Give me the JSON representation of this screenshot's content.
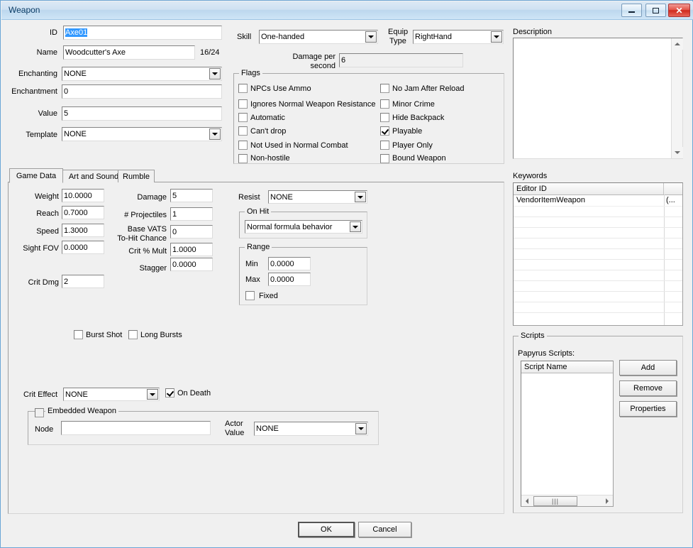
{
  "window": {
    "title": "Weapon",
    "controls": {
      "minimize": "minimize-button",
      "maximize": "maximize-button",
      "close": "close-button"
    }
  },
  "identity": {
    "id_label": "ID",
    "id_value": "Axe01",
    "name_label": "Name",
    "name_value": "Woodcutter's Axe",
    "name_counter": "16/24",
    "enchanting_label": "Enchanting",
    "enchanting_value": "NONE",
    "enchantment_label": "Enchantment",
    "enchantment_value": "0",
    "value_label": "Value",
    "value_value": "5",
    "template_label": "Template",
    "template_value": "NONE"
  },
  "combat": {
    "skill_label": "Skill",
    "skill_value": "One-handed",
    "equip_type_label_line1": "Equip",
    "equip_type_label_line2": "Type",
    "equip_type_value": "RightHand",
    "dps_label_line1": "Damage per",
    "dps_label_line2": "second",
    "dps_value": "6"
  },
  "flags": {
    "title": "Flags",
    "left": [
      {
        "label": "NPCs Use Ammo",
        "checked": false
      },
      {
        "label": "Ignores Normal Weapon Resistance",
        "checked": false
      },
      {
        "label": "Automatic",
        "checked": false
      },
      {
        "label": "Can't drop",
        "checked": false
      },
      {
        "label": "Not Used in Normal Combat",
        "checked": false
      },
      {
        "label": "Non-hostile",
        "checked": false
      }
    ],
    "right": [
      {
        "label": "No Jam After Reload",
        "checked": false
      },
      {
        "label": "Minor Crime",
        "checked": false
      },
      {
        "label": "Hide Backpack",
        "checked": false
      },
      {
        "label": "Playable",
        "checked": true
      },
      {
        "label": "Player Only",
        "checked": false
      },
      {
        "label": "Bound Weapon",
        "checked": false
      }
    ]
  },
  "tabs": [
    {
      "label": "Game Data",
      "active": true
    },
    {
      "label": "Art and Sound",
      "active": false
    },
    {
      "label": "Rumble",
      "active": false
    }
  ],
  "game_data": {
    "weight_label": "Weight",
    "weight_value": "10.0000",
    "reach_label": "Reach",
    "reach_value": "0.7000",
    "speed_label": "Speed",
    "speed_value": "1.3000",
    "sight_fov_label": "Sight FOV",
    "sight_fov_value": "0.0000",
    "crit_dmg_label": "Crit Dmg",
    "crit_dmg_value": "2",
    "damage_label": "Damage",
    "damage_value": "5",
    "projectiles_label": "# Projectiles",
    "projectiles_value": "1",
    "vats_label_line1": "Base VATS",
    "vats_label_line2": "To-Hit Chance",
    "vats_value": "0",
    "crit_mult_label": "Crit % Mult",
    "crit_mult_value": "1.0000",
    "stagger_label": "Stagger",
    "stagger_value": "0.0000"
  },
  "resist": {
    "label": "Resist",
    "value": "NONE"
  },
  "on_hit": {
    "title": "On Hit",
    "value": "Normal formula behavior"
  },
  "range": {
    "title": "Range",
    "min_label": "Min",
    "min_value": "0.0000",
    "max_label": "Max",
    "max_value": "0.0000",
    "fixed_label": "Fixed",
    "fixed_checked": false
  },
  "burst": {
    "burst_shot_label": "Burst Shot",
    "burst_shot_checked": false,
    "long_bursts_label": "Long Bursts",
    "long_bursts_checked": false
  },
  "crit_effect": {
    "label": "Crit Effect",
    "value": "NONE",
    "on_death_label": "On Death",
    "on_death_checked": true
  },
  "embedded_weapon": {
    "title": "Embedded Weapon",
    "enabled": false,
    "node_label": "Node",
    "node_value": "",
    "actor_value_label_line1": "Actor",
    "actor_value_label_line2": "Value",
    "actor_value_value": "NONE"
  },
  "description": {
    "title": "Description",
    "value": ""
  },
  "keywords": {
    "title": "Keywords",
    "columns": [
      "Editor ID",
      ""
    ],
    "rows": [
      {
        "editor_id": "VendorItemWeapon",
        "extra": "(..."
      }
    ]
  },
  "scripts": {
    "title": "Scripts",
    "subtitle": "Papyrus Scripts:",
    "column": "Script Name",
    "rows": [],
    "add_label": "Add",
    "remove_label": "Remove",
    "properties_label": "Properties"
  },
  "footer": {
    "ok_label": "OK",
    "cancel_label": "Cancel"
  }
}
